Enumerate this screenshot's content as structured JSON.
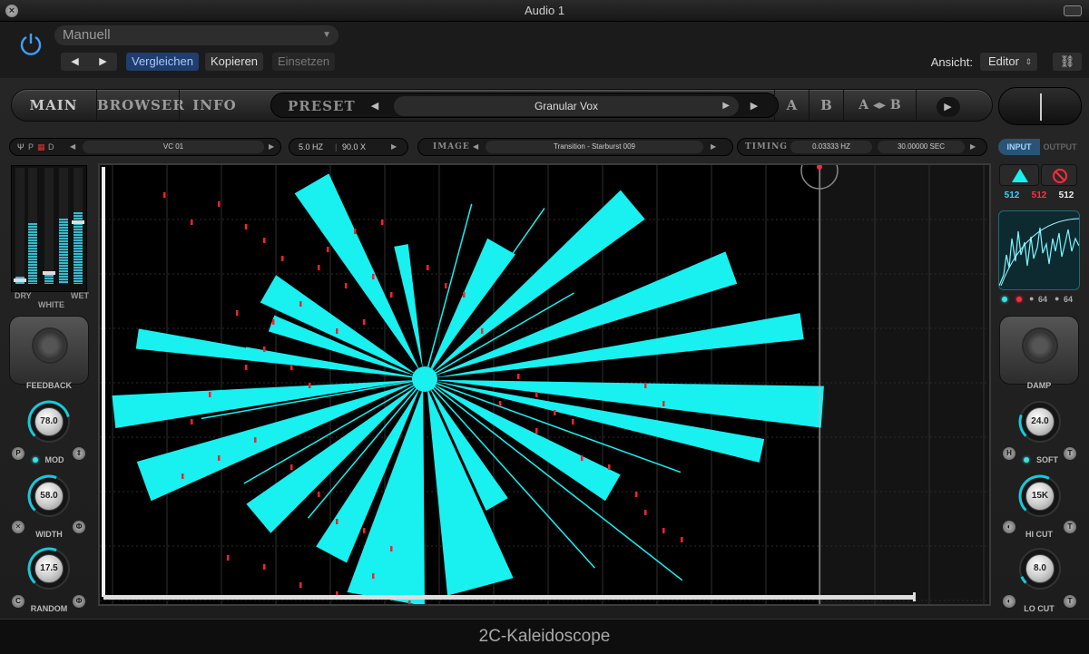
{
  "window": {
    "title": "Audio 1"
  },
  "host": {
    "preset_select": "Manuell",
    "prev_glyph": "◀",
    "next_glyph": "▶",
    "compare_label": "Vergleichen",
    "copy_label": "Kopieren",
    "paste_label": "Einsetzen",
    "view_label": "Ansicht:",
    "view_value": "Editor",
    "link_icon": "link-icon"
  },
  "plugin": {
    "name": "2C-Kaleidoscope",
    "tabs": [
      "MAIN",
      "BROWSER",
      "INFO"
    ],
    "preset_label": "PRESET",
    "preset_name": "Granular Vox",
    "ab": {
      "a": "A",
      "b": "B",
      "ab": "A ◂▸ B"
    },
    "source": {
      "mode_prefix": "P",
      "mode_suffix": "D",
      "name": "VC 01",
      "freq": "5.0 HZ",
      "amount": "90.0 X"
    },
    "image": {
      "label": "IMAGE",
      "name": "Transition - Starburst 009"
    },
    "timing": {
      "label": "TIMING",
      "freq": "0.03333 HZ",
      "seconds": "30.00000 SEC"
    },
    "io": {
      "input": "INPUT",
      "output": "OUTPUT"
    },
    "mix": {
      "dry": "DRY",
      "white": "WHITE",
      "wet": "WET"
    },
    "left_knobs": [
      {
        "label": "FEEDBACK",
        "value": "78.0",
        "fraction": 0.78
      },
      {
        "label": "MOD",
        "value": "58.0",
        "fraction": 0.58
      },
      {
        "label": "WIDTH",
        "value": "58.0",
        "fraction": 0.58
      },
      {
        "label": "RANDOM",
        "value": "17.5",
        "fraction": 0.175
      }
    ],
    "right_knobs": [
      {
        "label": "DAMP",
        "value": "24.0",
        "fraction": 0.24
      },
      {
        "label": "SOFT",
        "value": "15K",
        "fraction": 0.6
      },
      {
        "label": "HI CUT",
        "value": "15K",
        "fraction": 0.6
      },
      {
        "label": "LO CUT",
        "value": "8.0",
        "fraction": 0.08
      }
    ],
    "resolution": [
      "512",
      "512",
      "512"
    ],
    "rr": [
      "64",
      "64"
    ],
    "small_buttons": {
      "p": "P",
      "h": "H",
      "x": "✕",
      "phase": "Φ"
    },
    "colors": {
      "accent": "#19f0f0",
      "markers": "#ff2030",
      "input_tab": "#2a5477"
    }
  }
}
